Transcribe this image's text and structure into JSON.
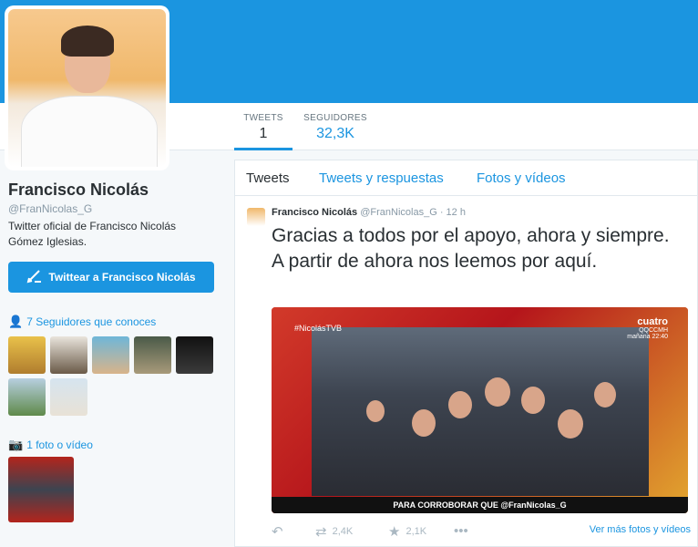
{
  "header": {
    "bg_color": "#1b95e0"
  },
  "nav": {
    "tweets_label": "TWEETS",
    "tweets_count": "1",
    "followers_label": "SEGUIDORES",
    "followers_count": "32,3K"
  },
  "profile": {
    "name": "Francisco Nicolás",
    "handle": "@FranNicolas_G",
    "bio": "Twitter oficial de Francisco Nicolás Gómez Iglesias.",
    "tweet_to_label": "Twittear a Francisco Nicolás"
  },
  "sidebar": {
    "followers_you_know": "7 Seguidores que conoces",
    "media_count": "1 foto o vídeo"
  },
  "timeline": {
    "tabs": [
      "Tweets",
      "Tweets y respuestas",
      "Fotos y vídeos"
    ]
  },
  "tweet": {
    "name": "Francisco Nicolás",
    "handle": "@FranNicolas_G",
    "time": "· 12 h",
    "text": "Gracias a todos por el apoyo, ahora y siempre. A partir de ahora nos leemos por aquí.",
    "media": {
      "hashtag": "#NicolásTVB",
      "logo_main": "cuatro",
      "logo_sub": "QQCCMH",
      "logo_time": "mañana 22:40",
      "caption": "PARA CORROBORAR QUE @FranNicolas_G"
    },
    "retweets": "2,4K",
    "likes": "2,1K",
    "more_label": "Ver más fotos y vídeos"
  },
  "colors": {
    "accent": "#1b95e0",
    "text": "#292f33",
    "muted": "#8899a6"
  }
}
